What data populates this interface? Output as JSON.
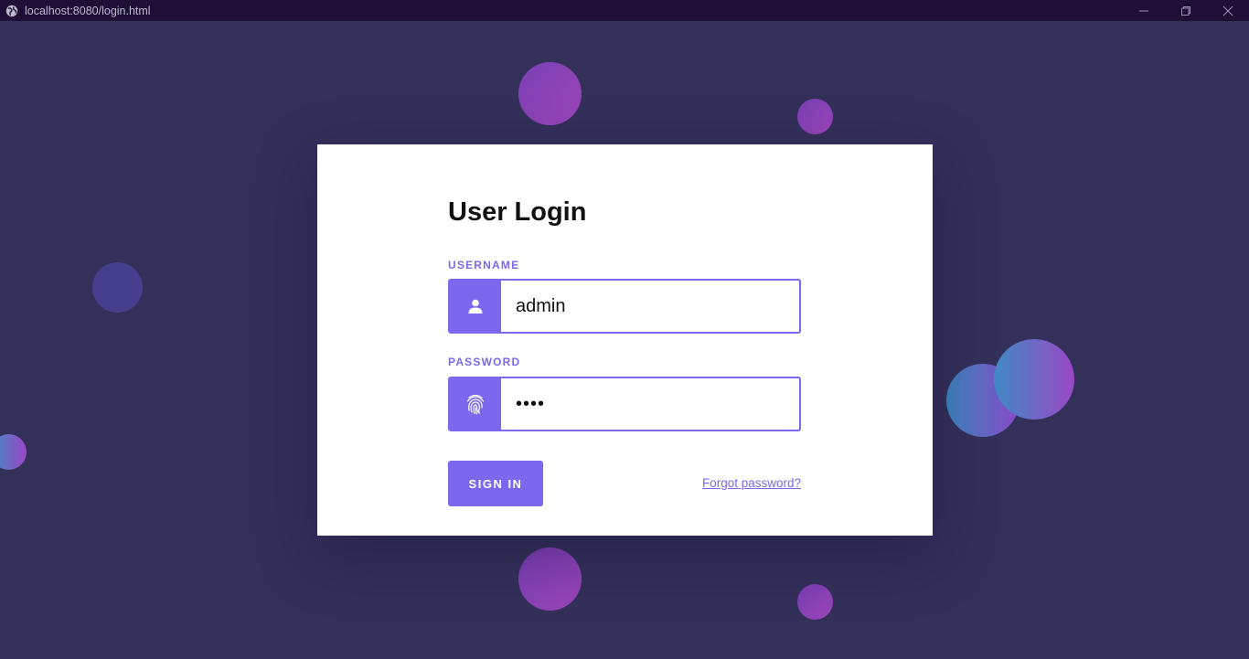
{
  "window": {
    "url": "localhost:8080/login.html"
  },
  "colors": {
    "background": "#33305a",
    "titlebar": "#1f0f36",
    "accent": "#7b68ee",
    "card": "#ffffff"
  },
  "login": {
    "title": "User Login",
    "username": {
      "label": "USERNAME",
      "value": "admin",
      "icon": "user-icon"
    },
    "password": {
      "label": "PASSWORD",
      "value": "••••",
      "icon": "fingerprint-icon"
    },
    "sign_in_label": "SIGN IN",
    "forgot_label": "Forgot password?"
  }
}
